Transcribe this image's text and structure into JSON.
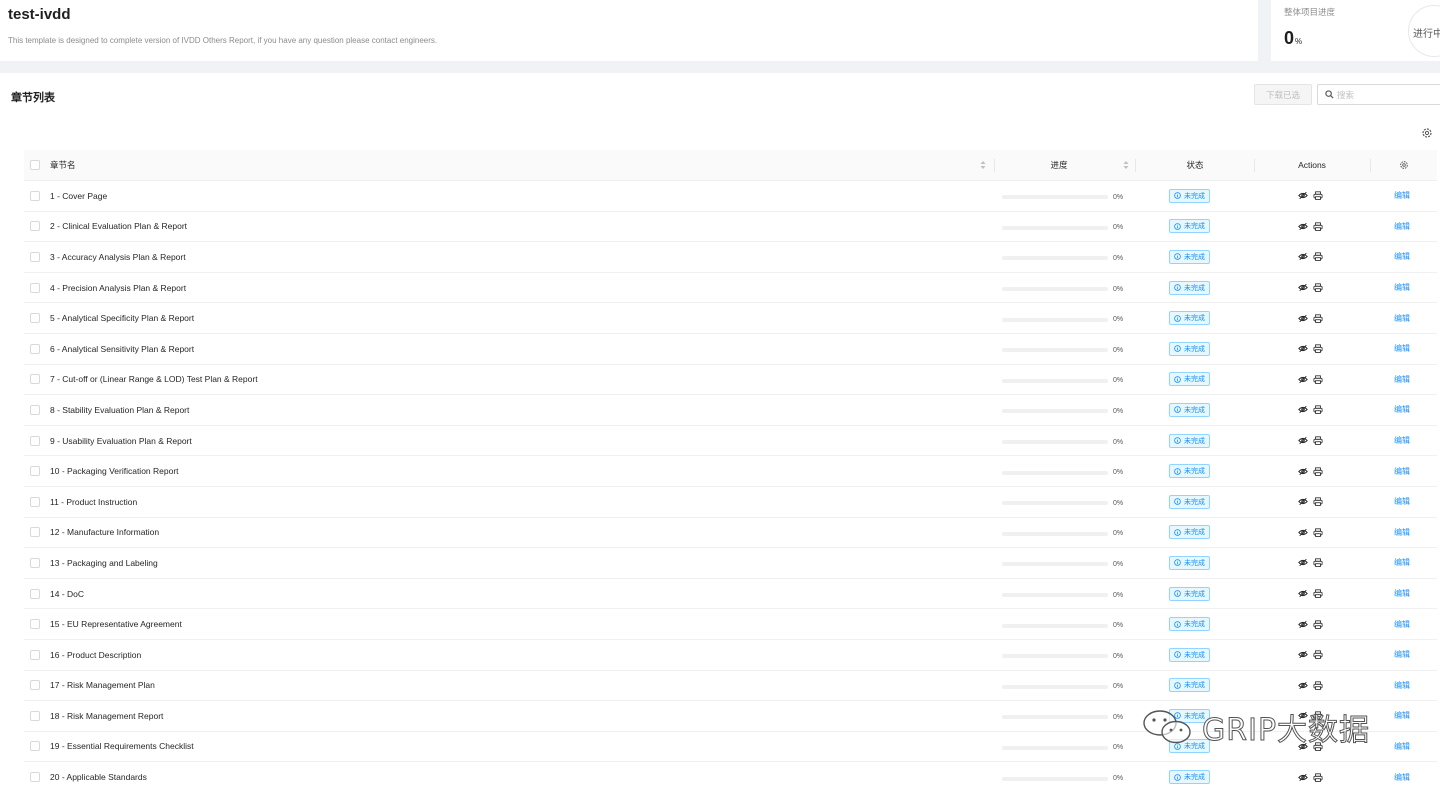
{
  "project": {
    "title": "test-ivdd",
    "description": "This template is designed to complete version of IVDD Others Report, if you have any question please contact engineers."
  },
  "overall": {
    "label": "整体项目进度",
    "value": "0",
    "unit": "%",
    "status": "进行中"
  },
  "section": {
    "title": "章节列表",
    "download_label": "下载已选",
    "search_placeholder": "搜索"
  },
  "table": {
    "headers": {
      "name": "章节名",
      "progress": "进度",
      "status": "状态",
      "actions": "Actions"
    },
    "rows": [
      {
        "name": "1 - Cover Page",
        "progress": 0,
        "progress_label": "0%",
        "status": "未完成",
        "edit": "编辑"
      },
      {
        "name": "2 - Clinical Evaluation Plan & Report",
        "progress": 0,
        "progress_label": "0%",
        "status": "未完成",
        "edit": "编辑"
      },
      {
        "name": "3 - Accuracy Analysis Plan & Report",
        "progress": 0,
        "progress_label": "0%",
        "status": "未完成",
        "edit": "编辑"
      },
      {
        "name": "4 - Precision Analysis Plan & Report",
        "progress": 0,
        "progress_label": "0%",
        "status": "未完成",
        "edit": "编辑"
      },
      {
        "name": "5 - Analytical Specificity Plan & Report",
        "progress": 0,
        "progress_label": "0%",
        "status": "未完成",
        "edit": "编辑"
      },
      {
        "name": "6 - Analytical Sensitivity Plan & Report",
        "progress": 0,
        "progress_label": "0%",
        "status": "未完成",
        "edit": "编辑"
      },
      {
        "name": "7 - Cut-off or (Linear Range & LOD) Test Plan & Report",
        "progress": 0,
        "progress_label": "0%",
        "status": "未完成",
        "edit": "编辑"
      },
      {
        "name": "8 - Stability Evaluation Plan & Report",
        "progress": 0,
        "progress_label": "0%",
        "status": "未完成",
        "edit": "编辑"
      },
      {
        "name": "9 - Usability Evaluation Plan & Report",
        "progress": 0,
        "progress_label": "0%",
        "status": "未完成",
        "edit": "编辑"
      },
      {
        "name": "10 - Packaging Verification Report",
        "progress": 0,
        "progress_label": "0%",
        "status": "未完成",
        "edit": "编辑"
      },
      {
        "name": "11 - Product Instruction",
        "progress": 0,
        "progress_label": "0%",
        "status": "未完成",
        "edit": "编辑"
      },
      {
        "name": "12 - Manufacture Information",
        "progress": 0,
        "progress_label": "0%",
        "status": "未完成",
        "edit": "编辑"
      },
      {
        "name": "13 - Packaging and Labeling",
        "progress": 0,
        "progress_label": "0%",
        "status": "未完成",
        "edit": "编辑"
      },
      {
        "name": "14 - DoC",
        "progress": 0,
        "progress_label": "0%",
        "status": "未完成",
        "edit": "编辑"
      },
      {
        "name": "15 - EU Representative Agreement",
        "progress": 0,
        "progress_label": "0%",
        "status": "未完成",
        "edit": "编辑"
      },
      {
        "name": "16 - Product Description",
        "progress": 0,
        "progress_label": "0%",
        "status": "未完成",
        "edit": "编辑"
      },
      {
        "name": "17 - Risk Management Plan",
        "progress": 0,
        "progress_label": "0%",
        "status": "未完成",
        "edit": "编辑"
      },
      {
        "name": "18 - Risk Management Report",
        "progress": 0,
        "progress_label": "0%",
        "status": "未完成",
        "edit": "编辑"
      },
      {
        "name": "19 - Essential Requirements Checklist",
        "progress": 0,
        "progress_label": "0%",
        "status": "未完成",
        "edit": "编辑"
      },
      {
        "name": "20 - Applicable Standards",
        "progress": 0,
        "progress_label": "0%",
        "status": "未完成",
        "edit": "编辑"
      }
    ]
  },
  "watermark": {
    "text": "GRIP大数据"
  },
  "icons": {
    "search": "search-icon",
    "settings": "gear-icon",
    "sort": "sort-icon",
    "info": "info-circle-icon",
    "hide": "eye-off-icon",
    "print": "printer-icon",
    "wechat": "wechat-icon"
  },
  "colors": {
    "accent": "#1890ff",
    "tag_bg": "#e6f7ff",
    "tag_border": "#91d5ff",
    "page_bg": "#f0f2f5"
  }
}
